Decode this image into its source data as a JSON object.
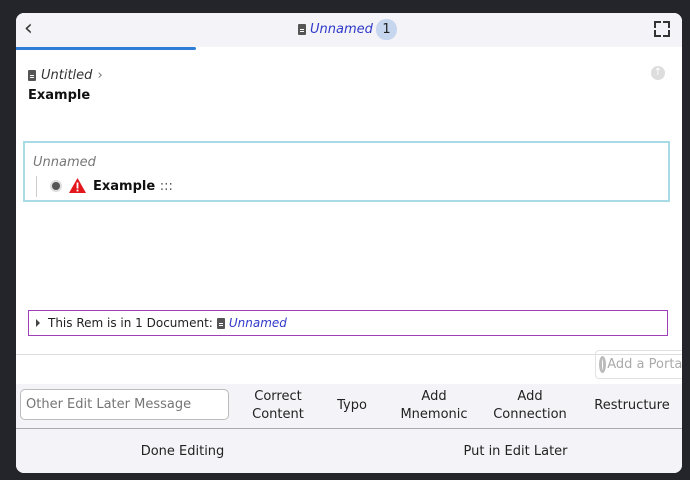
{
  "header": {
    "title": "Unnamed",
    "badge": "1",
    "back_icon": "chevron-left-icon",
    "fullscreen_icon": "fullscreen-icon"
  },
  "progress": {
    "fraction": 0.27,
    "color": "#2f7dd6"
  },
  "breadcrumb": {
    "parent": "Untitled",
    "separator": "›"
  },
  "page_title": "Example",
  "card": {
    "parent": "Unnamed",
    "rem": "Example",
    "rem_suffix": ":::"
  },
  "references": {
    "label": "This Rem is in 1 Document:",
    "doc": "Unnamed"
  },
  "portal": {
    "label": "Add a Portal"
  },
  "edit_later": {
    "placeholder": "Other Edit Later Message",
    "options": [
      {
        "line1": "Correct",
        "line2": "Content"
      },
      {
        "line1": "Typo",
        "line2": ""
      },
      {
        "line1": "Add",
        "line2": "Mnemonic"
      },
      {
        "line1": "Add",
        "line2": "Connection"
      },
      {
        "line1": "Restructure",
        "line2": ""
      }
    ]
  },
  "footer": {
    "done": "Done Editing",
    "later": "Put in Edit Later"
  }
}
